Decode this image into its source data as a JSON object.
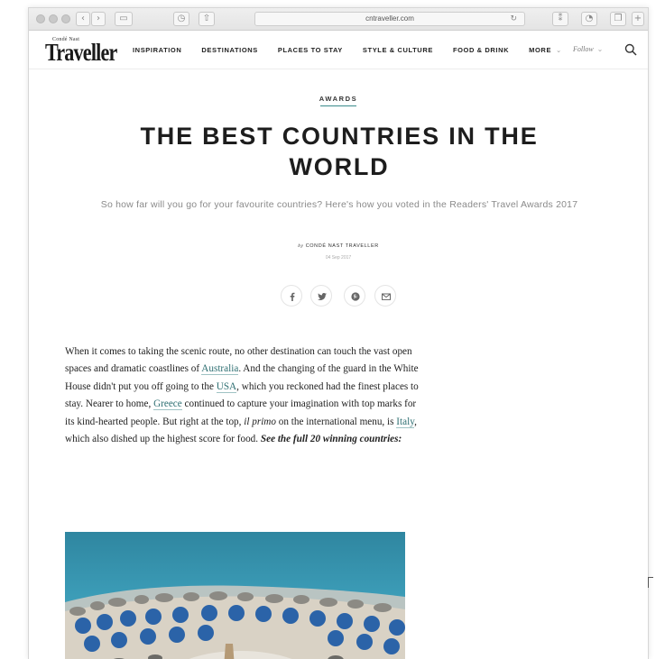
{
  "browser": {
    "url": "cntraveller.com"
  },
  "site": {
    "logo_small": "Condé Nast",
    "logo_main": "Traveller",
    "nav": [
      "INSPIRATION",
      "DESTINATIONS",
      "PLACES TO STAY",
      "STYLE & CULTURE",
      "FOOD & DRINK",
      "MORE"
    ],
    "follow": "Follow"
  },
  "article": {
    "kicker": "AWARDS",
    "headline": "THE BEST COUNTRIES IN THE WORLD",
    "dek": "So how far will you go for your favourite countries? Here's how you voted in the Readers' Travel Awards 2017",
    "byline_prefix": "by",
    "byline_author": "CONDÉ NAST TRAVELLER",
    "date": "04 Sep 2017",
    "body": {
      "p1": "When it comes to taking the scenic route, no other destination can touch the vast open spaces and dramatic coastlines of ",
      "link_australia": "Australia",
      "p2": ". And the changing of the guard in the White House didn't put you off going to the ",
      "link_usa": "USA",
      "p3": ", which you reckoned had the finest places to stay. Nearer to home, ",
      "link_greece": "Greece",
      "p4": " continued to capture your imagination with top marks for its kind-hearted people. But right at the top, ",
      "il_primo": "il primo",
      "p5": " on the international menu, is ",
      "link_italy": "Italy",
      "p6": ", which also dished up the highest score for food. ",
      "see_full": "See the full 20 winning countries:"
    }
  },
  "colors": {
    "link": "#2e6f72",
    "kicker_underline": "#3a8b8b",
    "sea": "#2f8aa6"
  }
}
